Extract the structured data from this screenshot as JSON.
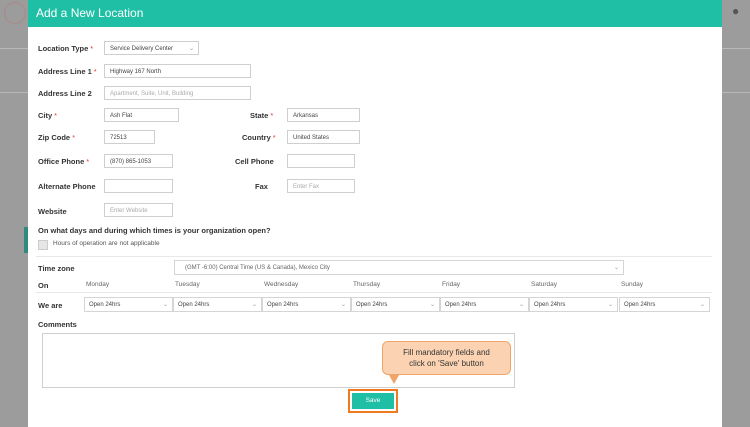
{
  "modal": {
    "title": "Add a New Location"
  },
  "form": {
    "location_type": {
      "label": "Location Type",
      "value": "Service Delivery Center"
    },
    "address1": {
      "label": "Address Line 1",
      "value": "Highway 167 North"
    },
    "address2": {
      "label": "Address Line 2",
      "placeholder": "Apartment, Suite, Unit, Building"
    },
    "city": {
      "label": "City",
      "value": "Ash Flat"
    },
    "state": {
      "label": "State",
      "value": "Arkansas"
    },
    "zip": {
      "label": "Zip Code",
      "value": "72513"
    },
    "country": {
      "label": "Country",
      "value": "United States"
    },
    "office_phone": {
      "label": "Office Phone",
      "value": "(870) 865-1053"
    },
    "cell_phone": {
      "label": "Cell Phone",
      "value": ""
    },
    "alternate_phone": {
      "label": "Alternate Phone",
      "value": ""
    },
    "fax": {
      "label": "Fax",
      "placeholder": "Enter Fax"
    },
    "website": {
      "label": "Website",
      "placeholder": "Enter Website"
    },
    "required_mark": "*"
  },
  "hours": {
    "question": "On what days and during which times is your organization open?",
    "not_applicable_label": "Hours of operation are not applicable",
    "timezone_label": "Time zone",
    "timezone_value": "(GMT -6:00) Central Time (US & Canada), Mexico City",
    "on_label": "On",
    "we_are_label": "We are",
    "days": [
      {
        "name": "Monday",
        "value": "Open 24hrs"
      },
      {
        "name": "Tuesday",
        "value": "Open 24hrs"
      },
      {
        "name": "Wednesday",
        "value": "Open 24hrs"
      },
      {
        "name": "Thursday",
        "value": "Open 24hrs"
      },
      {
        "name": "Friday",
        "value": "Open 24hrs"
      },
      {
        "name": "Saturday",
        "value": "Open 24hrs"
      },
      {
        "name": "Sunday",
        "value": "Open 24hrs"
      }
    ]
  },
  "comments": {
    "label": "Comments"
  },
  "callout": {
    "line1": "Fill mandatory fields and",
    "line2": "click on 'Save' button"
  },
  "actions": {
    "save_label": "Save"
  },
  "colors": {
    "accent": "#1fbfa6",
    "highlight": "#f07a22",
    "callout_bg": "#fbd3b2"
  }
}
